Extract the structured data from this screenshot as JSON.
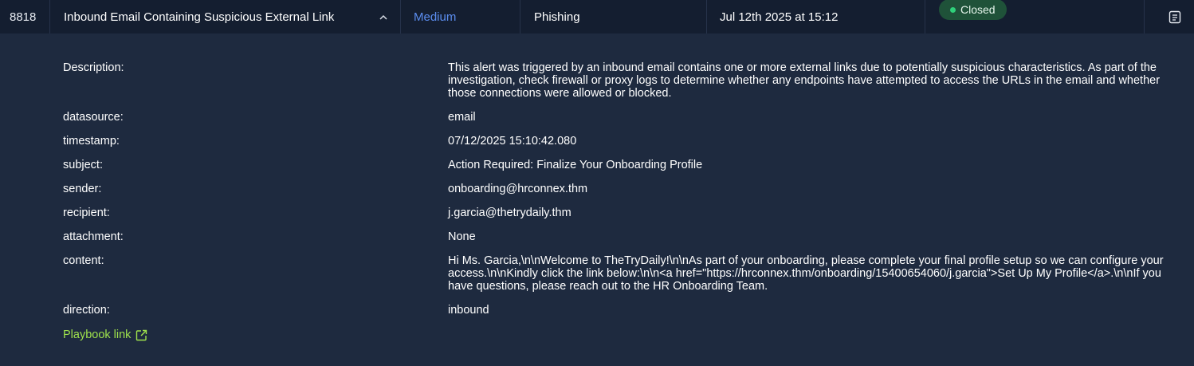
{
  "alert": {
    "id": "8818",
    "title": "Inbound Email Containing Suspicious External Link",
    "severity": "Medium",
    "category": "Phishing",
    "date": "Jul 12th 2025 at 15:12",
    "status": "Closed"
  },
  "details": {
    "description_label": "Description:",
    "description_value": "This alert was triggered by an inbound email contains one or more external links due to potentially suspicious characteristics. As part of the investigation, check firewall or proxy logs to determine whether any endpoints have attempted to access the URLs in the email and whether those connections were allowed or blocked.",
    "datasource_label": "datasource:",
    "datasource_value": "email",
    "timestamp_label": "timestamp:",
    "timestamp_value": "07/12/2025 15:10:42.080",
    "subject_label": "subject:",
    "subject_value": "Action Required: Finalize Your Onboarding Profile",
    "sender_label": "sender:",
    "sender_value": "onboarding@hrconnex.thm",
    "recipient_label": "recipient:",
    "recipient_value": "j.garcia@thetrydaily.thm",
    "attachment_label": "attachment:",
    "attachment_value": "None",
    "content_label": "content:",
    "content_value": "Hi Ms. Garcia,\\n\\nWelcome to TheTryDaily!\\n\\nAs part of your onboarding, please complete your final profile setup so we can configure your access.\\n\\nKindly click the link below:\\n\\n<a href=\"https://hrconnex.thm/onboarding/15400654060/j.garcia\">Set Up My Profile</a>.\\n\\nIf you have questions, please reach out to the HR Onboarding Team.",
    "direction_label": "direction:",
    "direction_value": "inbound",
    "playbook_label": "Playbook link"
  },
  "icons": {
    "chevron": "chevron-up-icon",
    "action": "document-icon",
    "external": "external-link-icon"
  },
  "colors": {
    "severity": "#5b8def",
    "status_bg": "#1f5239",
    "status_dot": "#2fd07a",
    "link": "#9fe24c"
  }
}
